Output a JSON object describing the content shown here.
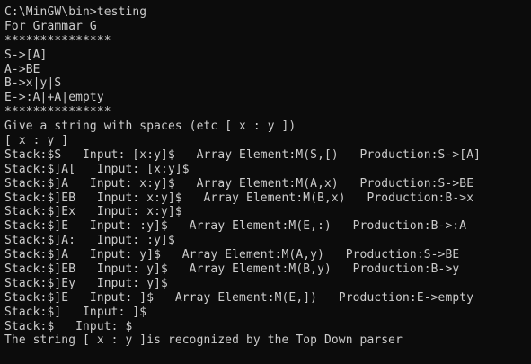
{
  "console": {
    "text_color": "#cccccc",
    "background_color": "#0c0c0c",
    "lines": [
      "C:\\MinGW\\bin>testing",
      "For Grammar G",
      "***************",
      "S->[A]",
      "A->BE",
      "B->x|y|S",
      "E->:A|+A|empty",
      "***************",
      "Give a string with spaces (etc [ x : y ])",
      "[ x : y ]",
      "Stack:$S   Input: [x:y]$   Array Element:M(S,[)   Production:S->[A]",
      "Stack:$]A[   Input: [x:y]$",
      "Stack:$]A   Input: x:y]$   Array Element:M(A,x)   Production:S->BE",
      "Stack:$]EB   Input: x:y]$   Array Element:M(B,x)   Production:B->x",
      "Stack:$]Ex   Input: x:y]$",
      "Stack:$]E   Input: :y]$   Array Element:M(E,:)   Production:B->:A",
      "Stack:$]A:   Input: :y]$",
      "Stack:$]A   Input: y]$   Array Element:M(A,y)   Production:S->BE",
      "Stack:$]EB   Input: y]$   Array Element:M(B,y)   Production:B->y",
      "Stack:$]Ey   Input: y]$",
      "Stack:$]E   Input: ]$   Array Element:M(E,])   Production:E->empty",
      "Stack:$]   Input: ]$",
      "Stack:$   Input: $",
      "The string [ x : y ]is recognized by the Top Down parser"
    ]
  }
}
